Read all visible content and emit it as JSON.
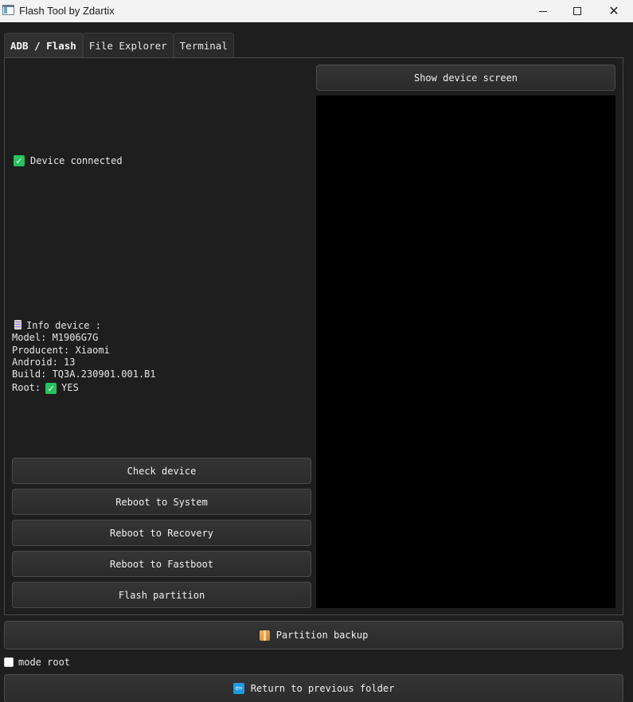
{
  "window": {
    "title": "Flash Tool by Zdartix",
    "minimize_glyph": "",
    "close_glyph": "✕"
  },
  "tabs": [
    {
      "label": "ADB / Flash",
      "active": true
    },
    {
      "label": "File Explorer",
      "active": false
    },
    {
      "label": "Terminal",
      "active": false
    }
  ],
  "status": {
    "icon": "check-icon",
    "check_glyph": "✓",
    "text": "Device connected",
    "color": "#27c25f"
  },
  "info": {
    "header": "Info device :",
    "model": "Model: M1906G7G",
    "producent": "Producent: Xiaomi",
    "android": "Android: 13",
    "build": "Build: TQ3A.230901.001.B1",
    "root_label": "Root:",
    "root_glyph": "✓",
    "root_value": "YES"
  },
  "buttons": {
    "check_device": "Check device",
    "reboot_system": "Reboot to System",
    "reboot_recovery": "Reboot to Recovery",
    "reboot_fastboot": "Reboot to Fastboot",
    "flash_partition": "Flash partition",
    "show_screen": "Show device screen",
    "partition_backup": "Partition backup",
    "return_folder": "Return to previous folder",
    "return_glyph": "⇦"
  },
  "mode_root": {
    "label": "mode root",
    "checked": false
  },
  "colors": {
    "background": "#1e1e1e",
    "accent_green": "#27c25f",
    "accent_blue": "#1e9be0",
    "screen": "#000000"
  }
}
